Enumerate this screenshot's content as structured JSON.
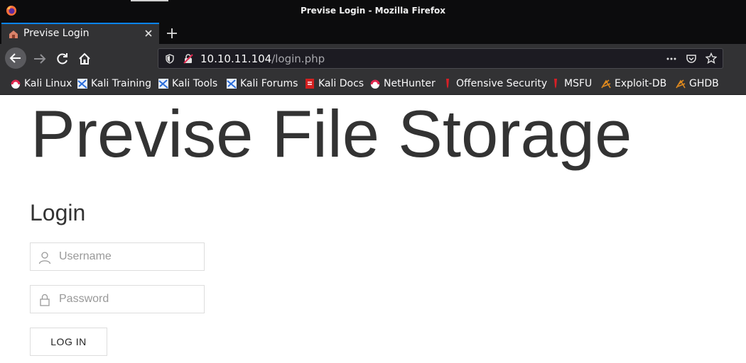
{
  "window": {
    "title": "Previse Login - Mozilla Firefox"
  },
  "tab": {
    "label": "Previse Login"
  },
  "url": {
    "host": "10.10.11.104",
    "path": "/login.php"
  },
  "bookmarks": [
    {
      "label": "Kali Linux",
      "icon": "kali-icon"
    },
    {
      "label": "Kali Training",
      "icon": "kali-training-icon"
    },
    {
      "label": "Kali Tools",
      "icon": "kali-tools-icon"
    },
    {
      "label": "Kali Forums",
      "icon": "kali-forums-icon"
    },
    {
      "label": "Kali Docs",
      "icon": "kali-docs-icon"
    },
    {
      "label": "NetHunter",
      "icon": "nethunter-icon"
    },
    {
      "label": "Offensive Security",
      "icon": "offsec-icon"
    },
    {
      "label": "MSFU",
      "icon": "msfu-icon"
    },
    {
      "label": "Exploit-DB",
      "icon": "exploitdb-icon"
    },
    {
      "label": "GHDB",
      "icon": "ghdb-icon"
    }
  ],
  "page": {
    "title": "Previse File Storage",
    "login_heading": "Login",
    "username_placeholder": "Username",
    "password_placeholder": "Password",
    "login_button": "LOG IN"
  },
  "colors": {
    "accent": "#0a84ff",
    "text": "#333333",
    "border": "#dddddd"
  }
}
